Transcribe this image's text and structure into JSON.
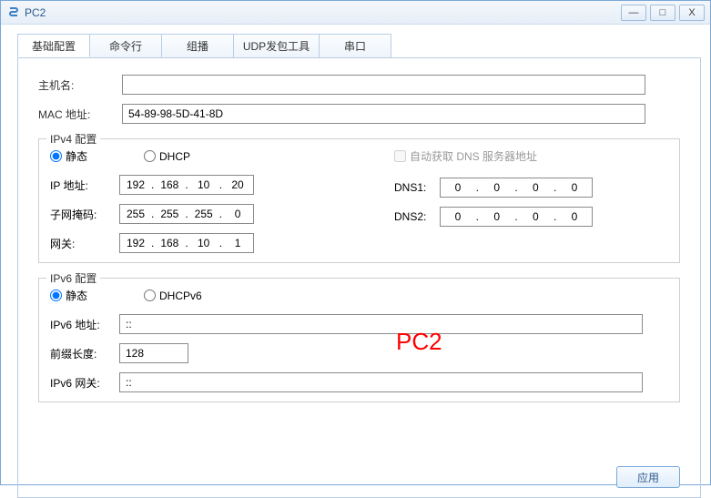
{
  "window": {
    "title": "PC2"
  },
  "tabs": [
    "基础配置",
    "命令行",
    "组播",
    "UDP发包工具",
    "串口"
  ],
  "basic": {
    "host_label": "主机名:",
    "host_value": "",
    "mac_label": "MAC 地址:",
    "mac_value": "54-89-98-5D-41-8D"
  },
  "ipv4": {
    "legend": "IPv4 配置",
    "static_label": "静态",
    "dhcp_label": "DHCP",
    "autodns_label": "自动获取 DNS 服务器地址",
    "ip_label": "IP 地址:",
    "ip": [
      "192",
      "168",
      "10",
      "20"
    ],
    "mask_label": "子网掩码:",
    "mask": [
      "255",
      "255",
      "255",
      "0"
    ],
    "gw_label": "网关:",
    "gw": [
      "192",
      "168",
      "10",
      "1"
    ],
    "dns1_label": "DNS1:",
    "dns1": [
      "0",
      "0",
      "0",
      "0"
    ],
    "dns2_label": "DNS2:",
    "dns2": [
      "0",
      "0",
      "0",
      "0"
    ]
  },
  "ipv6": {
    "legend": "IPv6 配置",
    "static_label": "静态",
    "dhcp_label": "DHCPv6",
    "addr_label": "IPv6 地址:",
    "addr_value": "::",
    "prefix_label": "前缀长度:",
    "prefix_value": "128",
    "gw_label": "IPv6 网关:",
    "gw_value": "::"
  },
  "apply_label": "应用",
  "overlay": "PC2"
}
